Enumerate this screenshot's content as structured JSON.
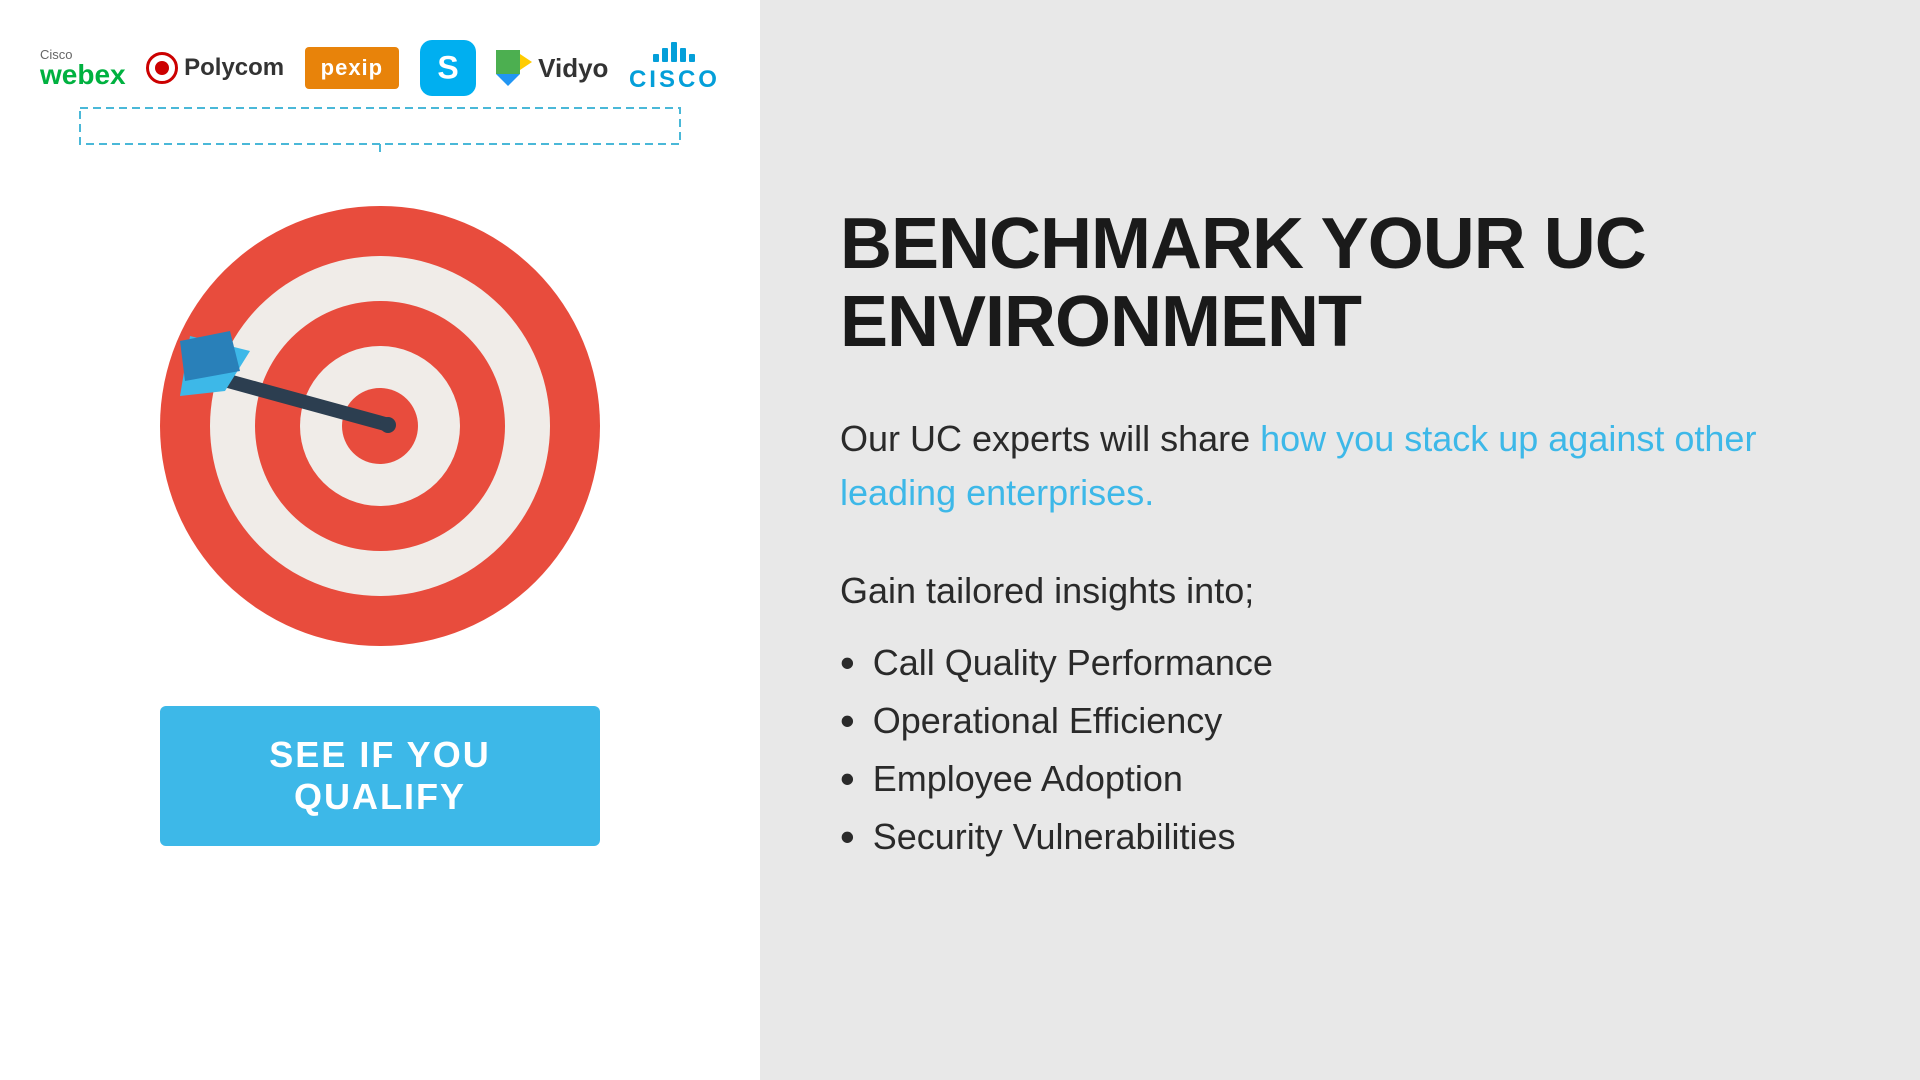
{
  "left": {
    "logos": [
      {
        "id": "webex",
        "name": "Cisco Webex"
      },
      {
        "id": "polycom",
        "name": "Polycom"
      },
      {
        "id": "pexip",
        "name": "pexip"
      },
      {
        "id": "skype",
        "name": "Skype"
      },
      {
        "id": "vidyo",
        "name": "Vidyo"
      },
      {
        "id": "cisco",
        "name": "CISCO"
      }
    ],
    "cta_label": "SEE IF YOU QUALIFY"
  },
  "right": {
    "headline": "BENCHMARK YOUR UC ENVIRONMENT",
    "description_prefix": "Our UC experts will share ",
    "description_highlight": "how you stack up against other leading enterprises.",
    "insights_intro": "Gain tailored insights into;",
    "insights": [
      "Call Quality Performance",
      "Operational Efficiency",
      "Employee Adoption",
      "Security Vulnerabilities"
    ]
  }
}
